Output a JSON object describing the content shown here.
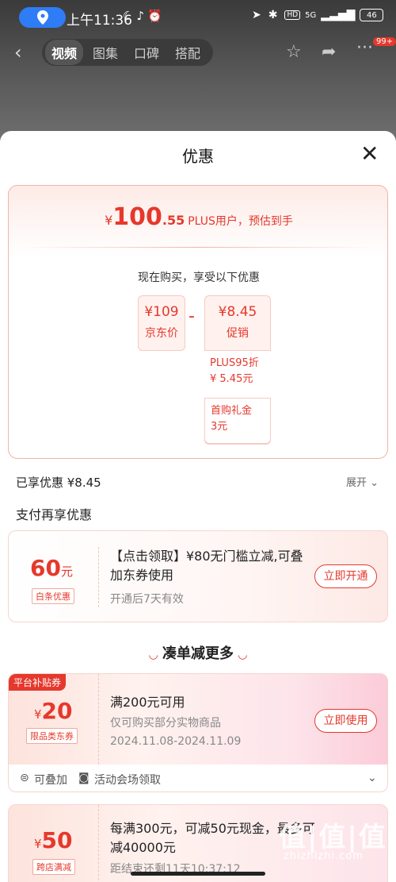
{
  "status_bar": {
    "time": "上午11:36",
    "signal": "5G",
    "battery": "46"
  },
  "nav": {
    "tabs": [
      "视频",
      "图集",
      "口碑",
      "搭配"
    ],
    "active_tab": 0,
    "badge": "99+"
  },
  "sheet": {
    "title": "优惠",
    "estimate": {
      "symbol": "¥",
      "integer": "100",
      "decimal": ".55",
      "label": "PLUS用户，预估到手"
    },
    "subtitle": "现在购买，享受以下优惠",
    "jd_price": {
      "value": "¥109",
      "label": "京东价"
    },
    "minus": "-",
    "promo": {
      "value_symbol": "¥",
      "value": "8.45",
      "label": "促销"
    },
    "promo_items": [
      {
        "line1": "PLUS95折",
        "line2": "¥ 5.45元"
      },
      {
        "line1": "首购礼金",
        "line2": "3元"
      }
    ],
    "enjoyed": "已享优惠 ¥8.45",
    "expand": "展开",
    "pay_more": "支付再享优惠"
  },
  "baitiao_card": {
    "amount": "60",
    "unit": "元",
    "tag": "白条优惠",
    "title": "【点击领取】¥80无门槛立减,可叠加东券使用",
    "note": "开通后7天有效",
    "button": "立即开通"
  },
  "more_section": {
    "title": "凑单减更多"
  },
  "coupon1": {
    "corner": "平台补贴券",
    "symbol": "¥",
    "amount": "20",
    "tag": "限品类东券",
    "title": "满200元可用",
    "desc": "仅可购买部分实物商品",
    "date": "2024.11.08-2024.11.09",
    "button": "立即使用",
    "foot_stack": "可叠加",
    "foot_source": "活动会场领取"
  },
  "coupon2": {
    "symbol": "¥",
    "amount": "50",
    "tag": "跨店满减",
    "title": "每满300元，可减50元现金，最多可减40000元",
    "line3": "距结束还剩11天10:37:12"
  },
  "watermark": {
    "big": "值|值|值",
    "small": "zhizhizhi.com"
  },
  "colors": {
    "accent": "#e6382c",
    "pill": "#2e7cf6"
  }
}
